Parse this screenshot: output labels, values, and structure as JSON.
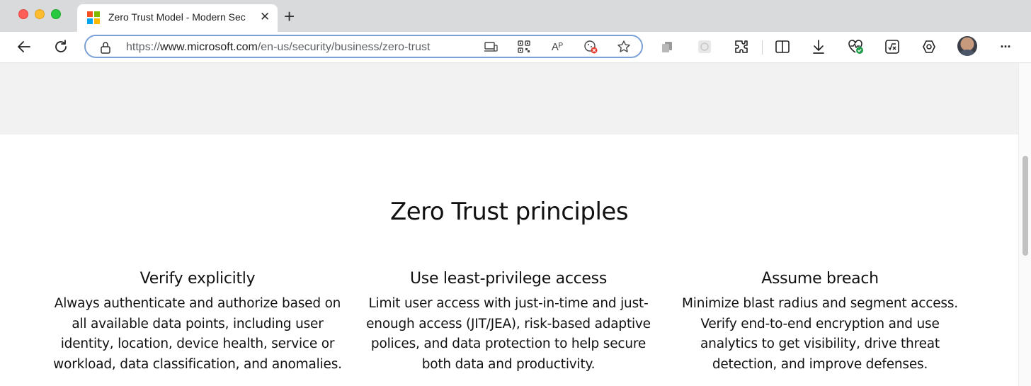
{
  "browser": {
    "tab": {
      "title": "Zero Trust Model - Modern Sec",
      "close": "✕",
      "favicon_colors": [
        "#f25022",
        "#7fba00",
        "#00a4ef",
        "#ffb900"
      ]
    },
    "new_tab": "+",
    "address": {
      "url_prefix": "https://",
      "url_domain": "www.microsoft.com",
      "url_path": "/en-us/security/business/zero-trust"
    },
    "icons": {
      "back": "back-arrow-icon",
      "refresh": "refresh-icon",
      "lock": "lock-icon",
      "app_available": "app-available-icon",
      "qr": "qr-code-icon",
      "read_aloud": "read-aloud-icon",
      "tracking": "tracking-prevention-icon",
      "favorite": "star-icon",
      "collections": "collections-icon",
      "extension_puzzle": "extensions-icon",
      "split": "split-screen-icon",
      "downloads": "download-icon",
      "health": "browser-essentials-icon",
      "math": "math-solver-icon",
      "copilot": "copilot-icon",
      "more": "more-icon"
    },
    "read_aloud_glyph": "Aᴾ",
    "more_glyph": "···"
  },
  "page": {
    "section_title": "Zero Trust principles",
    "principles": [
      {
        "title": "Verify explicitly",
        "body": "Always authenticate and authorize based on all available data points, including user identity, location, device health, service or workload, data classification, and anomalies."
      },
      {
        "title": "Use least-privilege access",
        "body": "Limit user access with just-in-time and just-enough access (JIT/JEA), risk-based adaptive polices, and data protection to help secure both data and productivity."
      },
      {
        "title": "Assume breach",
        "body": "Minimize blast radius and segment access. Verify end-to-end encryption and use analytics to get visibility, drive threat detection, and improve defenses."
      }
    ]
  },
  "colors": {
    "gray_band": "#f2f2f2",
    "address_focus": "#7aa0d8"
  }
}
